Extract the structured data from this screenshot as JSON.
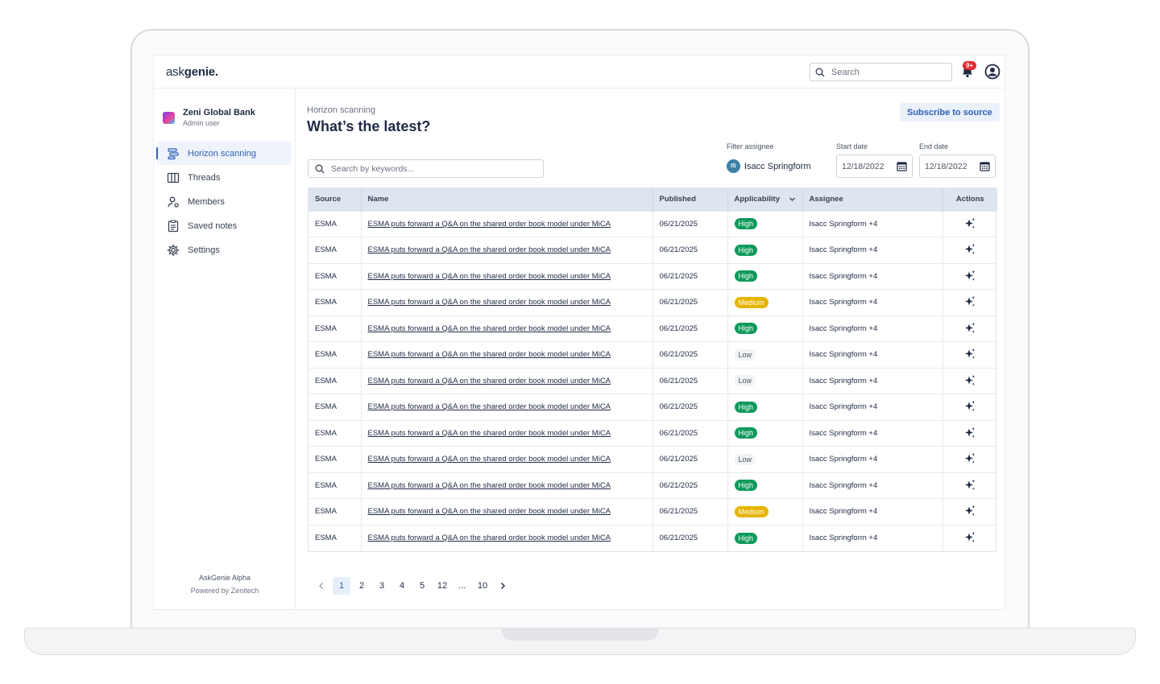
{
  "app": {
    "logo_prefix": "ask",
    "logo_bold": "genie.",
    "search_placeholder": "Search",
    "notification_count": "9+"
  },
  "sidebar": {
    "org_name": "Zeni Global Bank",
    "org_role": "Admin user",
    "items": [
      {
        "label": "Horizon scanning",
        "icon": "horizon-icon",
        "active": true
      },
      {
        "label": "Threads",
        "icon": "columns-icon",
        "active": false
      },
      {
        "label": "Members",
        "icon": "members-icon",
        "active": false
      },
      {
        "label": "Saved notes",
        "icon": "notes-icon",
        "active": false
      },
      {
        "label": "Settings",
        "icon": "gear-icon",
        "active": false
      }
    ],
    "footer_title": "AskGenie Alpha",
    "footer_sub": "Powered by Zenitech"
  },
  "main": {
    "breadcrumb": "Horizon scanning",
    "title": "What’s the latest?",
    "subscribe_label": "Subscribe to source",
    "keyword_placeholder": "Search by keywords...",
    "filter_assignee_label": "Filter assignee",
    "filter_assignee_initials": "IS",
    "filter_assignee_name": "Isacc Springform",
    "start_date_label": "Start date",
    "start_date": "12/18/2022",
    "end_date_label": "End date",
    "end_date": "12/18/2022"
  },
  "table": {
    "columns": [
      "Source",
      "Name",
      "Published",
      "Applicability",
      "Assignee",
      "Actions"
    ],
    "rows": [
      {
        "source": "ESMA",
        "name": "ESMA puts forward a Q&A on the shared order book model under MiCA",
        "published": "06/21/2025",
        "applicability": "High",
        "assignee": "Isacc Springform +4"
      },
      {
        "source": "ESMA",
        "name": "ESMA puts forward a Q&A on the shared order book model under MiCA",
        "published": "06/21/2025",
        "applicability": "High",
        "assignee": "Isacc Springform +4"
      },
      {
        "source": "ESMA",
        "name": "ESMA puts forward a Q&A on the shared order book model under MiCA",
        "published": "06/21/2025",
        "applicability": "High",
        "assignee": "Isacc Springform +4"
      },
      {
        "source": "ESMA",
        "name": "ESMA puts forward a Q&A on the shared order book model under MiCA",
        "published": "06/21/2025",
        "applicability": "Medium",
        "assignee": "Isacc Springform +4"
      },
      {
        "source": "ESMA",
        "name": "ESMA puts forward a Q&A on the shared order book model under MiCA",
        "published": "06/21/2025",
        "applicability": "High",
        "assignee": "Isacc Springform +4"
      },
      {
        "source": "ESMA",
        "name": "ESMA puts forward a Q&A on the shared order book model under MiCA",
        "published": "06/21/2025",
        "applicability": "Low",
        "assignee": "Isacc Springform +4"
      },
      {
        "source": "ESMA",
        "name": "ESMA puts forward a Q&A on the shared order book model under MiCA",
        "published": "06/21/2025",
        "applicability": "Low",
        "assignee": "Isacc Springform +4"
      },
      {
        "source": "ESMA",
        "name": "ESMA puts forward a Q&A on the shared order book model under MiCA",
        "published": "06/21/2025",
        "applicability": "High",
        "assignee": "Isacc Springform +4"
      },
      {
        "source": "ESMA",
        "name": "ESMA puts forward a Q&A on the shared order book model under MiCA",
        "published": "06/21/2025",
        "applicability": "High",
        "assignee": "Isacc Springform +4"
      },
      {
        "source": "ESMA",
        "name": "ESMA puts forward a Q&A on the shared order book model under MiCA",
        "published": "06/21/2025",
        "applicability": "Low",
        "assignee": "Isacc Springform +4"
      },
      {
        "source": "ESMA",
        "name": "ESMA puts forward a Q&A on the shared order book model under MiCA",
        "published": "06/21/2025",
        "applicability": "High",
        "assignee": "Isacc Springform +4"
      },
      {
        "source": "ESMA",
        "name": "ESMA puts forward a Q&A on the shared order book model under MiCA",
        "published": "06/21/2025",
        "applicability": "Medium",
        "assignee": "Isacc Springform +4"
      },
      {
        "source": "ESMA",
        "name": "ESMA puts forward a Q&A on the shared order book model under MiCA",
        "published": "06/21/2025",
        "applicability": "High",
        "assignee": "Isacc Springform +4"
      }
    ]
  },
  "pagination": {
    "pages": [
      "1",
      "2",
      "3",
      "4",
      "5",
      "12",
      "...",
      "10"
    ],
    "current": "1"
  },
  "colors": {
    "accent": "#2f5fb5",
    "high": "#0f9a5c",
    "medium": "#e6b400",
    "low": "#f1f2f4"
  }
}
